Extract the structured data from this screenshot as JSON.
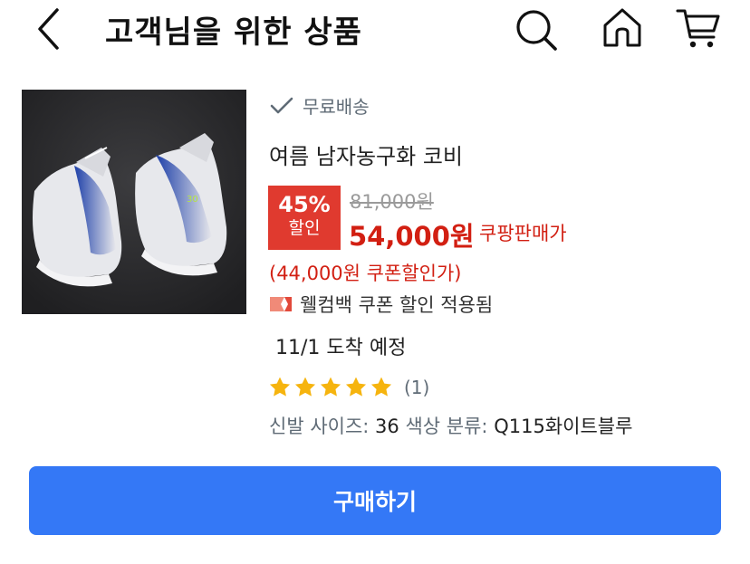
{
  "header": {
    "title": "고객님을 위한 상품",
    "back_icon": "chevron-left-icon",
    "search_icon": "search-icon",
    "home_icon": "home-icon",
    "cart_icon": "cart-icon"
  },
  "product": {
    "image_alt": "shoe-image",
    "shipping": "무료배송",
    "name": "여름 남자농구화 코비",
    "discount_percent": "45%",
    "discount_label": "할인",
    "original_price": "81,000원",
    "sale_price": "54,000원",
    "sale_price_label": "쿠팡판매가",
    "coupon_price": "(44,000원 쿠폰할인가)",
    "coupon_note": "웰컴백 쿠폰 할인 적용됨",
    "delivery": "11/1 도착 예정",
    "rating": 5,
    "review_count": "(1)",
    "option1_label": "신발 사이즈:",
    "option1_value": "36",
    "option2_label": "색상 분류:",
    "option2_value": "Q115화이트블루"
  },
  "colors": {
    "accent_blue": "#3478f6",
    "price_red": "#d21f12",
    "badge_red": "#e03a2f",
    "star_yellow": "#f6b40e"
  },
  "buy_button": {
    "label": "구매하기"
  }
}
